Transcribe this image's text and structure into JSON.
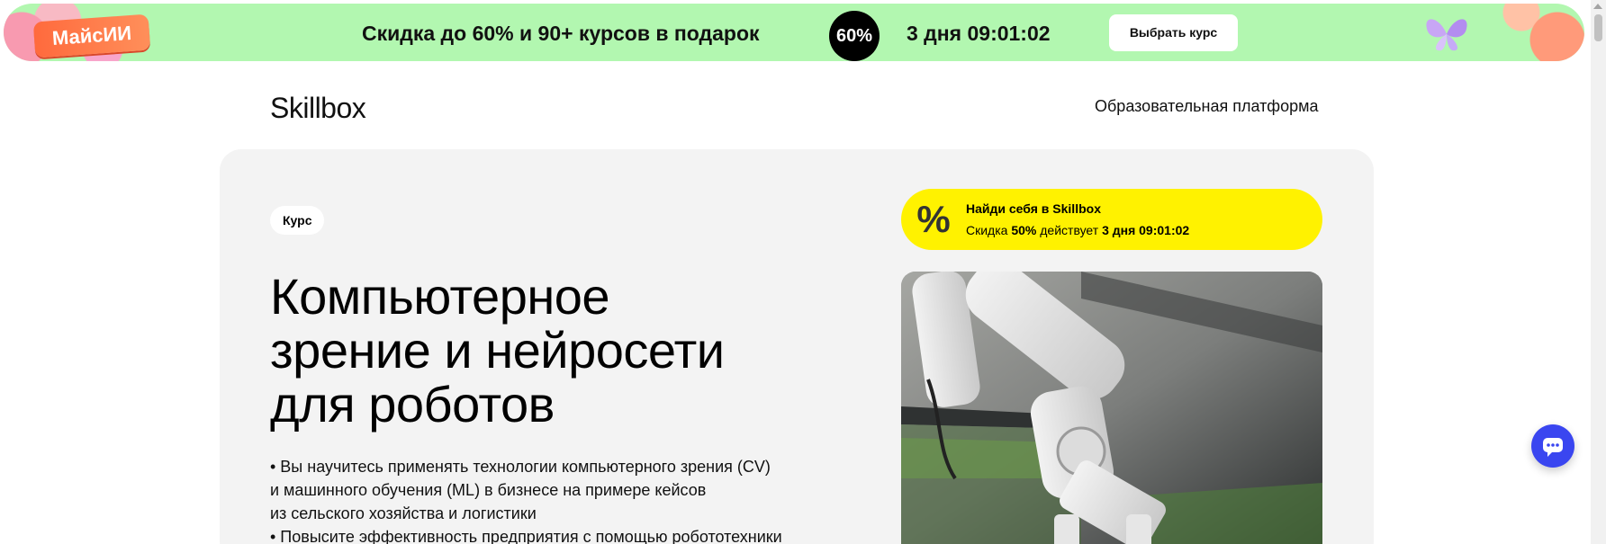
{
  "promo": {
    "badge": "МайсИИ",
    "text": "Скидка до 60% и 90+ курсов в подарок",
    "circle": "60%",
    "timer": "3 дня 09:01:02",
    "button": "Выбрать курс"
  },
  "header": {
    "logo": "Skillbox",
    "platform_link": "Образовательная платформа"
  },
  "hero": {
    "tag": "Курс",
    "title_lines": [
      "Компьютерное",
      "зрение и нейросети",
      "для роботов"
    ],
    "bullets": [
      "• Вы научитесь применять технологии компьютерного зрения (CV)",
      "и машинного обучения (ML) в бизнесе на примере кейсов",
      "из сельского хозяйства и логистики",
      "• Повысите эффективность предприятия с помощью робототехники"
    ]
  },
  "discount": {
    "title": "Найди себя в Skillbox",
    "sub_prefix": "Скидка ",
    "sub_percent": "50%",
    "sub_middle": " действует ",
    "sub_time": "3 дня 09:01:02"
  },
  "colors": {
    "promo_bg": "#b2f7b0",
    "discount_bg": "#fff200",
    "hero_bg": "#f3f3f3",
    "chat_bg": "#3a46f0"
  }
}
